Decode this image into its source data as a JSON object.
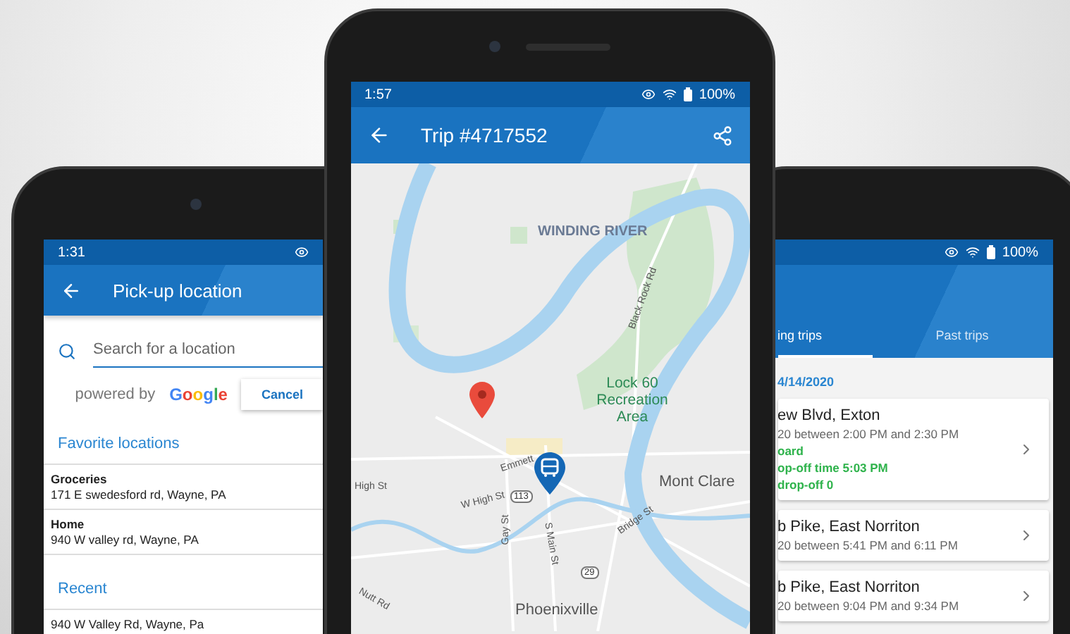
{
  "left_phone": {
    "status_time": "1:31",
    "title": "Pick-up location",
    "search": {
      "placeholder": "Search for a location"
    },
    "powered_by": "powered by",
    "brand": "Google",
    "cancel_button": "Cancel",
    "sections": [
      {
        "title": "Favorite locations",
        "items": [
          {
            "name": "Groceries",
            "address": "171 E swedesford rd, Wayne, PA"
          },
          {
            "name": "Home",
            "address": "940 W valley rd, Wayne, PA"
          }
        ]
      },
      {
        "title": "Recent",
        "items": [
          {
            "address": "940 W Valley Rd, Wayne, Pa"
          }
        ]
      }
    ]
  },
  "center_phone": {
    "status_time": "1:57",
    "battery": "100%",
    "title": "Trip #4717552",
    "map_labels": [
      {
        "kind": "area",
        "text": "WINDING RIVER"
      },
      {
        "kind": "road",
        "text": "Black Rock Rd"
      },
      {
        "kind": "park",
        "text": "Lock 60 Recreation Area"
      },
      {
        "kind": "road",
        "text": "Emmett"
      },
      {
        "kind": "road",
        "text": "High St"
      },
      {
        "kind": "road",
        "text": "W High St"
      },
      {
        "kind": "shield",
        "text": "113"
      },
      {
        "kind": "road",
        "text": "Gay St"
      },
      {
        "kind": "road",
        "text": "S Main St"
      },
      {
        "kind": "road",
        "text": "Bridge St"
      },
      {
        "kind": "town",
        "text": "Mont Clare"
      },
      {
        "kind": "shield",
        "text": "29"
      },
      {
        "kind": "road",
        "text": "Nutt Rd"
      },
      {
        "kind": "town",
        "text": "Phoenixville"
      }
    ]
  },
  "right_phone": {
    "battery": "100%",
    "tabs": [
      {
        "label": "ing trips",
        "selected": true
      },
      {
        "label": "Past trips",
        "selected": false
      }
    ],
    "date": "4/14/2020",
    "trips": [
      {
        "place": "ew Blvd, Exton",
        "time": "20 between 2:00 PM and 2:30 PM",
        "notes": [
          "oard",
          "op-off time 5:03 PM",
          "drop-off 0"
        ]
      },
      {
        "place": "b Pike, East Norriton",
        "time": "20 between 5:41 PM and 6:11 PM"
      },
      {
        "place": "b Pike, East Norriton",
        "time": "20 between 9:04 PM and 9:34 PM"
      }
    ]
  }
}
